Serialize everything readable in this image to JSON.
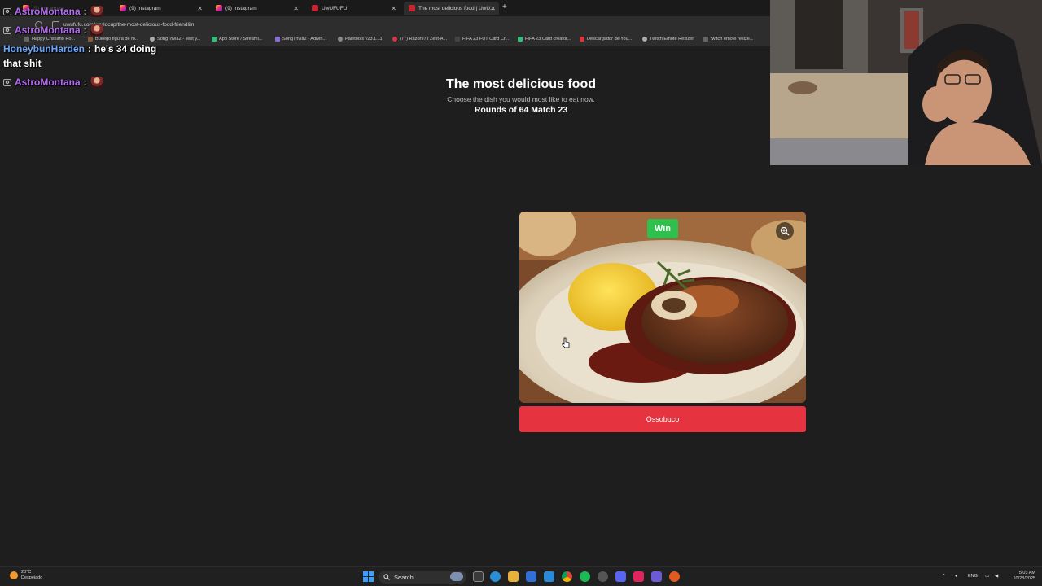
{
  "browser": {
    "tabs": [
      {
        "label": "(9) Instagram",
        "favicon": "instagram-icon"
      },
      {
        "label": "(9) Instagram",
        "favicon": "instagram-icon"
      },
      {
        "label": "(9) Instagram",
        "favicon": "instagram-icon"
      },
      {
        "label": "UwUFUFU",
        "favicon": "uwufufu-icon"
      },
      {
        "label": "The most delicious food | UwU...",
        "favicon": "uwufufu-icon"
      }
    ],
    "url": "uwufufu.com/worldcup/the-most-delicious-food-friendliin",
    "bookmarks": [
      "Happy Cristiano Ro...",
      "Bueego figura de fo...",
      "SongTrivia2 - Test y...",
      "App Store / Streami...",
      "SongTrivia2 - Adivin...",
      "Paletools v23.1.11",
      "(77) Razor97s Zest-A...",
      "FIFA 23 FUT Card Cr...",
      "FIFA 23 Card creator...",
      "Descargador de You...",
      "Twitch Emote Resizer",
      "twitch emote resize..."
    ]
  },
  "chat": [
    {
      "user": "AstroMontana",
      "sep": ":",
      "message": ""
    },
    {
      "user": "AstroMontana",
      "sep": ":",
      "message": ""
    },
    {
      "user": "HoneybunHarden",
      "sep": ":",
      "message": "he's 34 doing"
    },
    {
      "user": "",
      "sep": "",
      "message": "that shit"
    },
    {
      "user": "AstroMontana",
      "sep": ":",
      "message": ""
    }
  ],
  "game": {
    "title": "The most delicious food",
    "subtitle": "Choose the dish you would most like to eat now.",
    "round": "Rounds of 64 Match 23",
    "win_label": "Win",
    "choice_label": "Ossobuco"
  },
  "taskbar": {
    "weather_temp": "23°C",
    "weather_desc": "Despejado",
    "search_label": "Search",
    "language": "ENG",
    "time": "5:03 AM",
    "date": "10/28/2025"
  },
  "colors": {
    "win_green": "#2fbf4d",
    "choice_red": "#e5333f",
    "chat_purple": "#b36cf2",
    "chat_blue": "#6aa6ff"
  }
}
